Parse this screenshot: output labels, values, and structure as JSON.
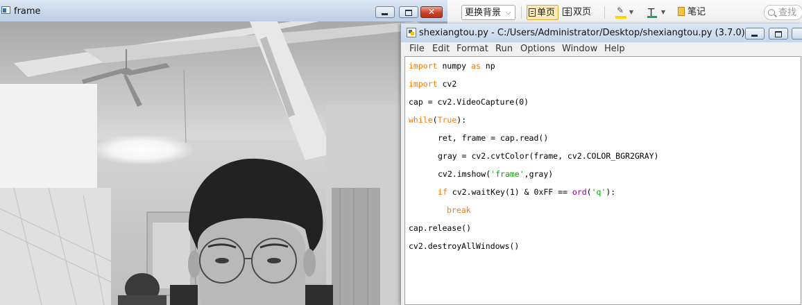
{
  "frame_window": {
    "title": "frame",
    "buttons": {
      "minimize": "minimize",
      "maximize": "maximize",
      "close": "✕"
    }
  },
  "reader_toolbar": {
    "background_dropdown": "更换背景",
    "single_page": "单页",
    "double_page": "双页",
    "highlight_icon": "highlighter-icon",
    "text_color_label": "T",
    "notes": "笔记",
    "search_placeholder": "查找",
    "highlight_color": "#ffd500",
    "text_color": "#1aa35a"
  },
  "idle_window": {
    "title": "shexiangtou.py - C:/Users/Administrator/Desktop/shexiangtou.py (3.7.0)",
    "menu": [
      "File",
      "Edit",
      "Format",
      "Run",
      "Options",
      "Window",
      "Help"
    ],
    "code": [
      [
        {
          "t": "import",
          "c": "kw"
        },
        {
          "t": " numpy ",
          "c": ""
        },
        {
          "t": "as",
          "c": "kw"
        },
        {
          "t": " np",
          "c": ""
        }
      ],
      [
        {
          "t": "import",
          "c": "kw"
        },
        {
          "t": " cv2",
          "c": ""
        }
      ],
      [
        {
          "t": "cap = cv2.VideoCapture(0)",
          "c": ""
        }
      ],
      [
        {
          "t": "while",
          "c": "kw"
        },
        {
          "t": "(",
          "c": ""
        },
        {
          "t": "True",
          "c": "kw"
        },
        {
          "t": "):",
          "c": ""
        }
      ],
      [
        {
          "t": "ret, frame = cap.read()",
          "c": ""
        }
      ],
      [
        {
          "t": "gray = cv2.cvtColor(frame, cv2.COLOR_BGR2GRAY)",
          "c": ""
        }
      ],
      [
        {
          "t": "cv2.imshow(",
          "c": ""
        },
        {
          "t": "'frame'",
          "c": "str"
        },
        {
          "t": ",gray)",
          "c": ""
        }
      ],
      [
        {
          "t": "if",
          "c": "kw"
        },
        {
          "t": " cv2.waitKey(1) & 0xFF == ",
          "c": ""
        },
        {
          "t": "ord",
          "c": "bi"
        },
        {
          "t": "(",
          "c": ""
        },
        {
          "t": "'q'",
          "c": "str"
        },
        {
          "t": "):",
          "c": ""
        }
      ],
      [
        {
          "t": "break",
          "c": "kw"
        }
      ],
      [
        {
          "t": "cap.release()",
          "c": ""
        }
      ],
      [
        {
          "t": "cv2.destroyAllWindows()",
          "c": ""
        }
      ]
    ],
    "syntax_colors": {
      "keyword": "#ff7700",
      "builtin": "#900090",
      "string": "#00aa00"
    }
  }
}
